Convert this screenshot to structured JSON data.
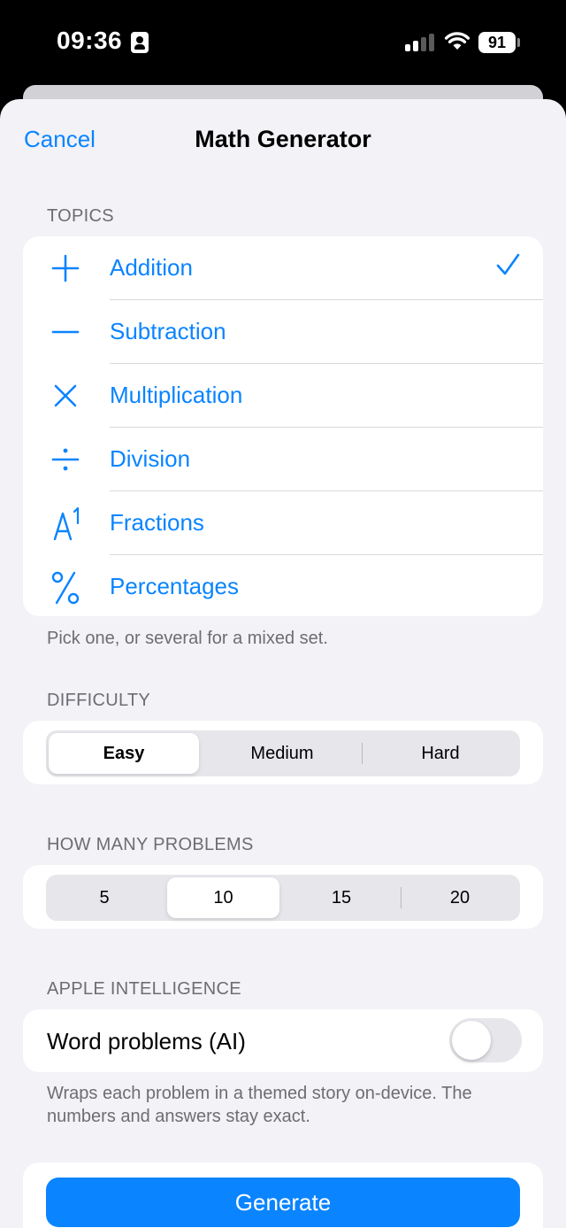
{
  "status_bar": {
    "time": "09:36",
    "battery": "91"
  },
  "nav": {
    "cancel_label": "Cancel",
    "title": "Math Generator"
  },
  "topics": {
    "header": "TOPICS",
    "items": [
      {
        "label": "Addition",
        "icon": "plus-icon",
        "selected": true
      },
      {
        "label": "Subtraction",
        "icon": "minus-icon",
        "selected": false
      },
      {
        "label": "Multiplication",
        "icon": "multiply-icon",
        "selected": false
      },
      {
        "label": "Division",
        "icon": "divide-icon",
        "selected": false
      },
      {
        "label": "Fractions",
        "icon": "superscript-icon",
        "selected": false
      },
      {
        "label": "Percentages",
        "icon": "percent-icon",
        "selected": false
      }
    ],
    "footer": "Pick one, or several for a mixed set."
  },
  "difficulty": {
    "header": "DIFFICULTY",
    "options": [
      "Easy",
      "Medium",
      "Hard"
    ],
    "selected": "Easy"
  },
  "problem_count": {
    "header": "HOW MANY PROBLEMS",
    "options": [
      "5",
      "10",
      "15",
      "20"
    ],
    "selected": "10"
  },
  "apple_intelligence": {
    "header": "APPLE INTELLIGENCE",
    "toggle_label": "Word problems (AI)",
    "toggle_on": false,
    "footer": "Wraps each problem in a themed story on-device. The numbers and answers stay exact."
  },
  "generate_label": "Generate",
  "colors": {
    "accent": "#0a84ff",
    "background": "#f2f2f7",
    "secondary_text": "#6d6d72"
  }
}
